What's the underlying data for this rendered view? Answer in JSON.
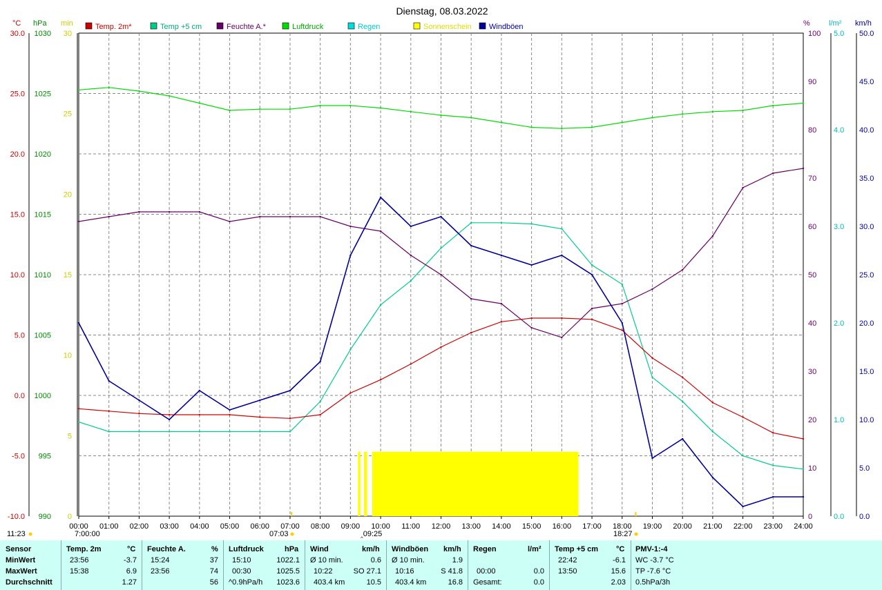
{
  "title": "Dienstag, 08.03.2022",
  "colors": {
    "temp2m": "#cc0000",
    "temp5cm": "#00cc88",
    "feuchte": "#660066",
    "luftdruck": "#00dd00",
    "regen": "#00dddd",
    "sonne": "#ffff00",
    "windboeen": "#000099",
    "panel_bg": "#ccfff6"
  },
  "chart_data": {
    "type": "line",
    "title": "Dienstag, 08.03.2022",
    "legend": [
      "Temp. 2m*",
      "Temp +5 cm",
      "Feuchte A.*",
      "Luftdruck",
      "Regen",
      "Sonnenschein",
      "Windböen"
    ],
    "axes": {
      "left_units": [
        "°C",
        "hPa",
        "min"
      ],
      "right_units": [
        "%",
        "l/m²",
        "km/h"
      ],
      "temp_ticks": [
        "30.0",
        "25.0",
        "20.0",
        "15.0",
        "10.0",
        "5.0",
        "0.0",
        "-5.0",
        "-10.0"
      ],
      "pressure_ticks": [
        "1030",
        "1025",
        "1020",
        "1015",
        "1010",
        "1005",
        "1000",
        "995",
        "990"
      ],
      "min_ticks": [
        "30",
        "25",
        "20",
        "15",
        "10",
        "5",
        "0"
      ],
      "humidity_ticks": [
        "100",
        "90",
        "80",
        "70",
        "60",
        "50",
        "40",
        "30",
        "20",
        "10",
        "0"
      ],
      "rain_ticks": [
        "5.0",
        "4.0",
        "3.0",
        "2.0",
        "1.0",
        "0.0"
      ],
      "wind_ticks": [
        "50.0",
        "45.0",
        "40.0",
        "35.0",
        "30.0",
        "25.0",
        "20.0",
        "15.0",
        "10.0",
        "5.0",
        "0.0"
      ],
      "x_ticks": [
        "00:00",
        "01:00",
        "02:00",
        "03:00",
        "04:00",
        "05:00",
        "06:00",
        "07:00",
        "08:00",
        "09:00",
        "10:00",
        "11:00",
        "12:00",
        "13:00",
        "14:00",
        "15:00",
        "16:00",
        "17:00",
        "18:00",
        "19:00",
        "20:00",
        "21:00",
        "22:00",
        "23:00",
        "24:00"
      ],
      "temp_range": [
        -10,
        30
      ],
      "pressure_range": [
        990,
        1030
      ],
      "humidity_range": [
        0,
        100
      ],
      "rain_range": [
        0,
        5
      ],
      "wind_range": [
        0,
        50
      ],
      "x_range_hours": [
        0,
        24
      ]
    },
    "sun_markers": {
      "left_label": "11:23",
      "rise_time": "07:03",
      "set_time": "18:27",
      "ticks": [
        "7:00:00",
        "07:03",
        "09:25",
        "18:27"
      ]
    },
    "series": [
      {
        "name": "Temp. 2m*",
        "unit": "°C",
        "x": [
          0,
          1,
          2,
          3,
          4,
          5,
          6,
          7,
          8,
          9,
          10,
          11,
          12,
          13,
          14,
          15,
          16,
          17,
          18,
          19,
          20,
          21,
          22,
          23,
          24
        ],
        "values": [
          -1.1,
          -1.3,
          -1.5,
          -1.6,
          -1.6,
          -1.6,
          -1.8,
          -1.9,
          -1.6,
          0.2,
          1.3,
          2.6,
          4.0,
          5.2,
          6.1,
          6.4,
          6.4,
          6.3,
          5.4,
          3.1,
          1.5,
          -0.6,
          -1.8,
          -3.1,
          -3.6
        ]
      },
      {
        "name": "Temp +5 cm",
        "unit": "°C",
        "x": [
          0,
          1,
          2,
          3,
          4,
          5,
          6,
          7,
          8,
          9,
          10,
          11,
          12,
          13,
          14,
          15,
          16,
          17,
          18,
          19,
          20,
          21,
          22,
          23,
          24
        ],
        "values": [
          -2.2,
          -3.0,
          -3.0,
          -3.0,
          -3.0,
          -3.0,
          -3.0,
          -3.0,
          -0.5,
          3.8,
          7.5,
          9.5,
          12.2,
          14.3,
          14.3,
          14.2,
          13.8,
          10.8,
          9.2,
          1.5,
          -0.5,
          -3.0,
          -5.0,
          -5.8,
          -6.1
        ]
      },
      {
        "name": "Feuchte A.*",
        "unit": "%",
        "x": [
          0,
          1,
          2,
          3,
          4,
          5,
          6,
          7,
          8,
          9,
          10,
          11,
          12,
          13,
          14,
          15,
          16,
          17,
          18,
          19,
          20,
          21,
          22,
          23,
          24
        ],
        "values": [
          61,
          62,
          63,
          63,
          63,
          61,
          62,
          62,
          62,
          60,
          59,
          54,
          50,
          45,
          44,
          39,
          37,
          43,
          44,
          47,
          51,
          58,
          68,
          71,
          72
        ]
      },
      {
        "name": "Luftdruck",
        "unit": "hPa",
        "x": [
          0,
          1,
          2,
          3,
          4,
          5,
          6,
          7,
          8,
          9,
          10,
          11,
          12,
          13,
          14,
          15,
          16,
          17,
          18,
          19,
          20,
          21,
          22,
          23,
          24
        ],
        "values": [
          1025.3,
          1025.5,
          1025.2,
          1024.8,
          1024.2,
          1023.6,
          1023.7,
          1023.7,
          1024.0,
          1024.0,
          1023.8,
          1023.5,
          1023.2,
          1023.0,
          1022.6,
          1022.2,
          1022.1,
          1022.2,
          1022.6,
          1023.0,
          1023.3,
          1023.5,
          1023.6,
          1024.0,
          1024.2
        ]
      },
      {
        "name": "Windböen",
        "unit": "km/h",
        "x": [
          0,
          1,
          2,
          3,
          4,
          5,
          6,
          7,
          8,
          9,
          10,
          11,
          12,
          13,
          14,
          15,
          16,
          17,
          18,
          19,
          20,
          21,
          22,
          23,
          24
        ],
        "values": [
          20,
          14,
          12,
          10,
          13,
          11,
          12,
          13,
          16,
          27,
          33,
          30,
          31,
          28,
          27,
          26,
          27,
          25,
          20,
          6,
          8,
          4,
          1,
          2,
          2
        ]
      }
    ],
    "sunshine_intervals": [
      [
        9.25,
        9.33
      ],
      [
        9.45,
        9.55
      ],
      [
        9.72,
        16.55
      ]
    ]
  },
  "stats": {
    "row_labels": [
      "Sensor",
      "MinWert",
      "MaxWert",
      "Durchschnitt"
    ],
    "temp2m": {
      "header": "Temp. 2m",
      "unit": "°C",
      "min_time": "23:56",
      "min": "-3.7",
      "max_time": "15:38",
      "max": "6.9",
      "avg": "1.27"
    },
    "feuchte": {
      "header": "Feuchte A.",
      "unit": "%",
      "min_time": "15:24",
      "min": "37",
      "max_time": "23:56",
      "max": "74",
      "avg": "56"
    },
    "luftdruck": {
      "header": "Luftdruck",
      "unit": "hPa",
      "min_time": "15:10",
      "min": "1022.1",
      "max_time": "00:30",
      "max": "1025.5",
      "avg_label": "^0.9hPa/h",
      "avg": "1023.6"
    },
    "wind": {
      "header": "Wind",
      "unit": "km/h",
      "min_label": "Ø 10 min.",
      "min": "0.6",
      "max_time": "10:22",
      "max": "SO 27.1",
      "avg_label": "403.4 km",
      "avg": "10.5"
    },
    "windboeen": {
      "header": "Windböen",
      "unit": "km/h",
      "min_label": "Ø 10 min.",
      "min": "1.9",
      "max_time": "10:16",
      "max": "S 41.8",
      "avg_label": "403.4 km",
      "avg": "16.8"
    },
    "regen": {
      "header": "Regen",
      "unit": "l/m²",
      "max_time": "00:00",
      "max": "0.0",
      "avg_label": "Gesamt:",
      "avg": "0.0"
    },
    "temp5cm": {
      "header": "Temp +5 cm",
      "unit": "°C",
      "min_time": "22:42",
      "min": "-6.1",
      "max_time": "13:50",
      "max": "15.6",
      "avg": "2.03"
    },
    "pmv": {
      "header": "PMV-1:-4",
      "min": "WC -3.7 °C",
      "max": "TP -7.6 °C",
      "avg": "0.5hPa/3h"
    }
  }
}
